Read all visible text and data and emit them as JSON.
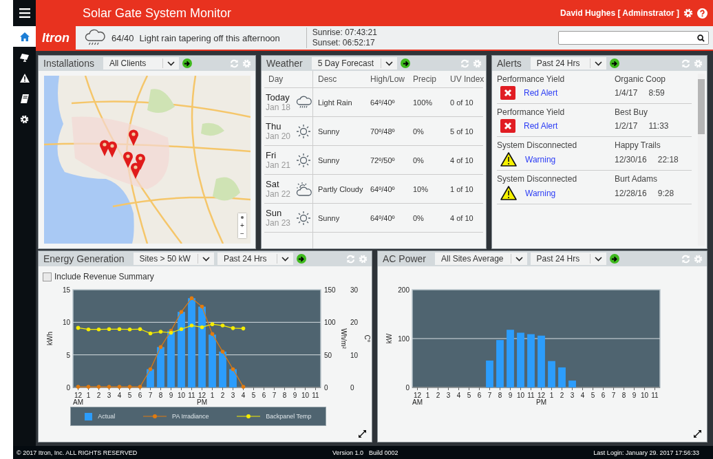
{
  "app": {
    "title": "Solar Gate System Monitor",
    "user": "David Hughes [ Adminstrator ]",
    "logo": "Itron"
  },
  "sidebar": {
    "items": [
      {
        "kind": "home",
        "selected": true
      },
      {
        "kind": "panel",
        "selected": false
      },
      {
        "kind": "warning",
        "selected": false
      },
      {
        "kind": "book",
        "selected": false
      },
      {
        "kind": "settings",
        "selected": false
      }
    ]
  },
  "weather_banner": {
    "temps": "64/40",
    "summary": "Light rain tapering off this afternoon",
    "sunrise": "Sunrise: 07:43:21",
    "sunset": "Sunset: 06:52:17"
  },
  "panels": {
    "installations": {
      "title": "Installations",
      "filters": [
        "All Clients"
      ],
      "map": {
        "zoom_in": "+",
        "zoom_out": "−"
      }
    },
    "weather": {
      "title": "Weather",
      "filters": [
        "5 Day Forecast"
      ],
      "columns": [
        "Day",
        "Desc",
        "High/Low",
        "Precip",
        "UV Index"
      ],
      "rows": [
        {
          "day": "Today",
          "date": "Jan 18",
          "kind": "rain",
          "desc": "Light Rain",
          "high_low": "64º/40º",
          "precip": "100%",
          "uv": "0 of 10"
        },
        {
          "day": "Thu",
          "date": "Jan 20",
          "kind": "sunny",
          "desc": "Sunny",
          "high_low": "70º/48º",
          "precip": "0%",
          "uv": "5 of 10"
        },
        {
          "day": "Fri",
          "date": "Jan 21",
          "kind": "sunny",
          "desc": "Sunny",
          "high_low": "72º/50º",
          "precip": "0%",
          "uv": "4 of 10"
        },
        {
          "day": "Sat",
          "date": "Jan 22",
          "kind": "partly-cloudy",
          "desc": "Partly Cloudy",
          "high_low": "64º/40º",
          "precip": "10%",
          "uv": "1 of 10"
        },
        {
          "day": "Sun",
          "date": "Jan 23",
          "kind": "sunny",
          "desc": "Sunny",
          "high_low": "64º/40º",
          "precip": "0%",
          "uv": "4 of 10"
        }
      ]
    },
    "alerts": {
      "title": "Alerts",
      "filters": [
        "Past 24 Hrs"
      ],
      "items": [
        {
          "type": "Performance Yield",
          "kind": "error",
          "status": "Red Alert",
          "site": "Organic Coop",
          "date": "1/4/17",
          "time": "8:59"
        },
        {
          "type": "Performance Yield",
          "kind": "error",
          "status": "Red Alert",
          "site": "Best Buy",
          "date": "1/2/17",
          "time": "11:33"
        },
        {
          "type": "System Disconnected",
          "kind": "warning",
          "status": "Warning",
          "site": "Happy Trails",
          "date": "12/30/16",
          "time": "22:18"
        },
        {
          "type": "System Disconnected",
          "kind": "warning",
          "status": "Warning",
          "site": "Burt Adams",
          "date": "12/28/16",
          "time": "9:28"
        }
      ]
    },
    "energy": {
      "title": "Energy Generation",
      "filters": [
        "Sites > 50 kW",
        "Past 24 Hrs"
      ],
      "revenue_summary": {
        "label": "Include Revenue Summary",
        "checked": false
      },
      "chart_data": [
        {
          "type": "bar",
          "ylabel": "kWh",
          "ylim": [
            0,
            15
          ],
          "yticks": [
            0,
            5,
            10,
            15
          ],
          "categories": [
            "12 AM",
            "1",
            "2",
            "3",
            "4",
            "5",
            "6",
            "7",
            "8",
            "9",
            "10",
            "11",
            "12 PM",
            "1",
            "2",
            "3",
            "4",
            "5",
            "6",
            "7",
            "8",
            "9",
            "10",
            "11"
          ],
          "series": [
            {
              "name": "Actual",
              "color": "#2c9dfc",
              "values": [
                0,
                0,
                0,
                0,
                0,
                0,
                0,
                2.8,
                6.2,
                8.7,
                11.6,
                13.7,
                12.4,
                8.1,
                5.5,
                2.8,
                0,
                0,
                0,
                0,
                0,
                0,
                0,
                0
              ]
            }
          ]
        },
        {
          "type": "line",
          "ylabel": "Wh/m²",
          "ylim": [
            0,
            150
          ],
          "yticks": [
            0,
            50,
            100,
            150
          ],
          "series": [
            {
              "name": "PA Irradiance",
              "color": "#e07b10",
              "values": [
                1,
                1,
                1,
                1,
                1,
                1,
                1,
                28,
                62,
                87,
                116,
                137,
                124,
                82,
                55,
                28,
                1,
                null,
                null,
                null,
                null,
                null,
                null,
                null
              ]
            }
          ]
        },
        {
          "type": "line",
          "ylabel": "C°",
          "ylim": [
            0,
            30
          ],
          "yticks": [
            0,
            10,
            20,
            30
          ],
          "series": [
            {
              "name": "Backpanel Temp",
              "color": "#f5ec00",
              "values": [
                18.3,
                17.8,
                17.8,
                17.9,
                17.9,
                17.8,
                17.9,
                16.6,
                17.1,
                16.8,
                17.9,
                19,
                18.5,
                19.4,
                19,
                18.2,
                18.1,
                null,
                null,
                null,
                null,
                null,
                null,
                null
              ]
            }
          ]
        }
      ]
    },
    "ac_power": {
      "title": "AC Power",
      "filters": [
        "All Sites Average",
        "Past 24 Hrs"
      ],
      "chart_data": {
        "type": "bar",
        "ylabel": "kW",
        "ylim": [
          0,
          200
        ],
        "yticks": [
          0,
          100,
          200
        ],
        "categories": [
          "12 AM",
          "1",
          "2",
          "3",
          "4",
          "5",
          "6",
          "7",
          "8",
          "9",
          "10",
          "11",
          "12 PM",
          "1",
          "2",
          "3",
          "4",
          "5",
          "6",
          "7",
          "8",
          "9",
          "10",
          "11"
        ],
        "values": [
          0,
          0,
          0,
          0,
          0,
          0,
          0,
          55,
          97,
          118,
          112,
          109,
          106,
          54,
          41,
          14,
          0,
          0,
          0,
          0,
          0,
          0,
          0,
          0
        ]
      }
    }
  },
  "footer": {
    "copyright": "© 2017  Itron, Inc. ALL RIGHTS RESERVED",
    "version": "Version 1.0",
    "build": "Build 0002",
    "last_login": "Last Login: January 29. 2017 17:56:33"
  }
}
